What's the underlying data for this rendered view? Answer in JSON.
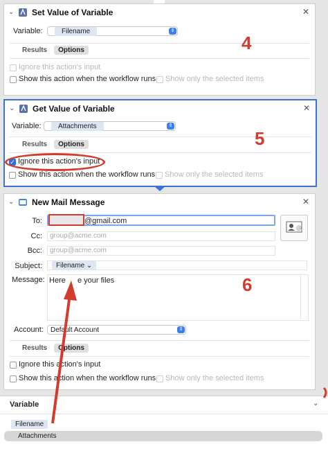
{
  "card1": {
    "title": "Set Value of Variable",
    "variable_label": "Variable:",
    "variable_value": "Filename",
    "tab_results": "Results",
    "tab_options": "Options",
    "ignore_input": "Ignore this action's input",
    "show_action": "Show this action when the workflow runs",
    "show_selected": "Show only the selected items",
    "annotation": "4"
  },
  "card2": {
    "title": "Get Value of Variable",
    "variable_label": "Variable:",
    "variable_value": "Attachments",
    "tab_results": "Results",
    "tab_options": "Options",
    "ignore_input": "Ignore this action's input",
    "show_action": "Show this action when the workflow runs",
    "show_selected": "Show only the selected items",
    "annotation": "5"
  },
  "card3": {
    "title": "New Mail Message",
    "to_label": "To:",
    "to_value": "@gmail.com",
    "cc_label": "Cc:",
    "cc_placeholder": "group@acme.com",
    "bcc_label": "Bcc:",
    "bcc_placeholder": "group@acme.com",
    "subject_label": "Subject:",
    "subject_token": "Filename",
    "message_label": "Message:",
    "message_value_a": "Here",
    "message_value_b": "e your files",
    "account_label": "Account:",
    "account_value": "Default Account",
    "tab_results": "Results",
    "tab_options": "Options",
    "ignore_input": "Ignore this action's input",
    "show_action": "Show this action when the workflow runs",
    "show_selected": "Show only the selected items",
    "annotation": "6"
  },
  "variables_panel": {
    "header": "Variable",
    "items": [
      "Filename",
      "Attachments"
    ]
  },
  "colors": {
    "accent": "#3b74d6",
    "annotation": "#d23b2e",
    "checkbox": "#2e6fe6"
  },
  "icons": [
    "chevron-down-icon",
    "variable-icon",
    "close-icon",
    "mail-icon",
    "contacts-icon"
  ]
}
